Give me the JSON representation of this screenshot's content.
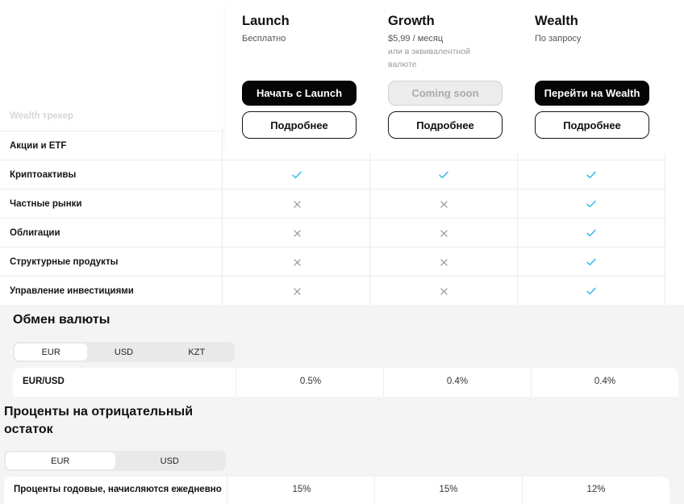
{
  "plans": [
    {
      "name": "Launch",
      "price": "Бесплатно",
      "note": "",
      "cta": "Начать с Launch",
      "cta_state": "primary",
      "details": "Подробнее"
    },
    {
      "name": "Growth",
      "price": "$5,99 / месяц",
      "note": "или в эквивалентной валюте",
      "cta": "Coming soon",
      "cta_state": "disabled",
      "details": "Подробнее"
    },
    {
      "name": "Wealth",
      "price": "По запросу",
      "note": "",
      "cta": "Перейти на Wealth",
      "cta_state": "primary",
      "details": "Подробнее"
    }
  ],
  "features": {
    "faded_row": "Wealth трекер",
    "rows": [
      {
        "label": "Акции и ETF",
        "values": [
          "",
          "",
          ""
        ]
      },
      {
        "label": "Криптоактивы",
        "values": [
          "check",
          "check",
          "check"
        ]
      },
      {
        "label": "Частные рынки",
        "values": [
          "cross",
          "cross",
          "check"
        ]
      },
      {
        "label": "Облигации",
        "values": [
          "cross",
          "cross",
          "check"
        ]
      },
      {
        "label": "Структурные продукты",
        "values": [
          "cross",
          "cross",
          "check"
        ]
      },
      {
        "label": "Управление инвестициями",
        "values": [
          "cross",
          "cross",
          "check"
        ]
      }
    ]
  },
  "colors": {
    "check": "#2bb7e8",
    "cross": "#9a9a9a",
    "section_bg": "#f4f4f4"
  },
  "fx": {
    "title": "Обмен валюты",
    "tabs": [
      "EUR",
      "USD",
      "KZT"
    ],
    "active_tab": 0,
    "row": {
      "label": "EUR/USD",
      "values": [
        "0.5%",
        "0.4%",
        "0.4%"
      ]
    }
  },
  "negative_balance": {
    "title": "Проценты на отрицательный остаток",
    "tabs": [
      "EUR",
      "USD"
    ],
    "active_tab": 0,
    "row": {
      "label": "Проценты годовые, начисляются ежедневно",
      "values": [
        "15%",
        "15%",
        "12%"
      ]
    }
  }
}
